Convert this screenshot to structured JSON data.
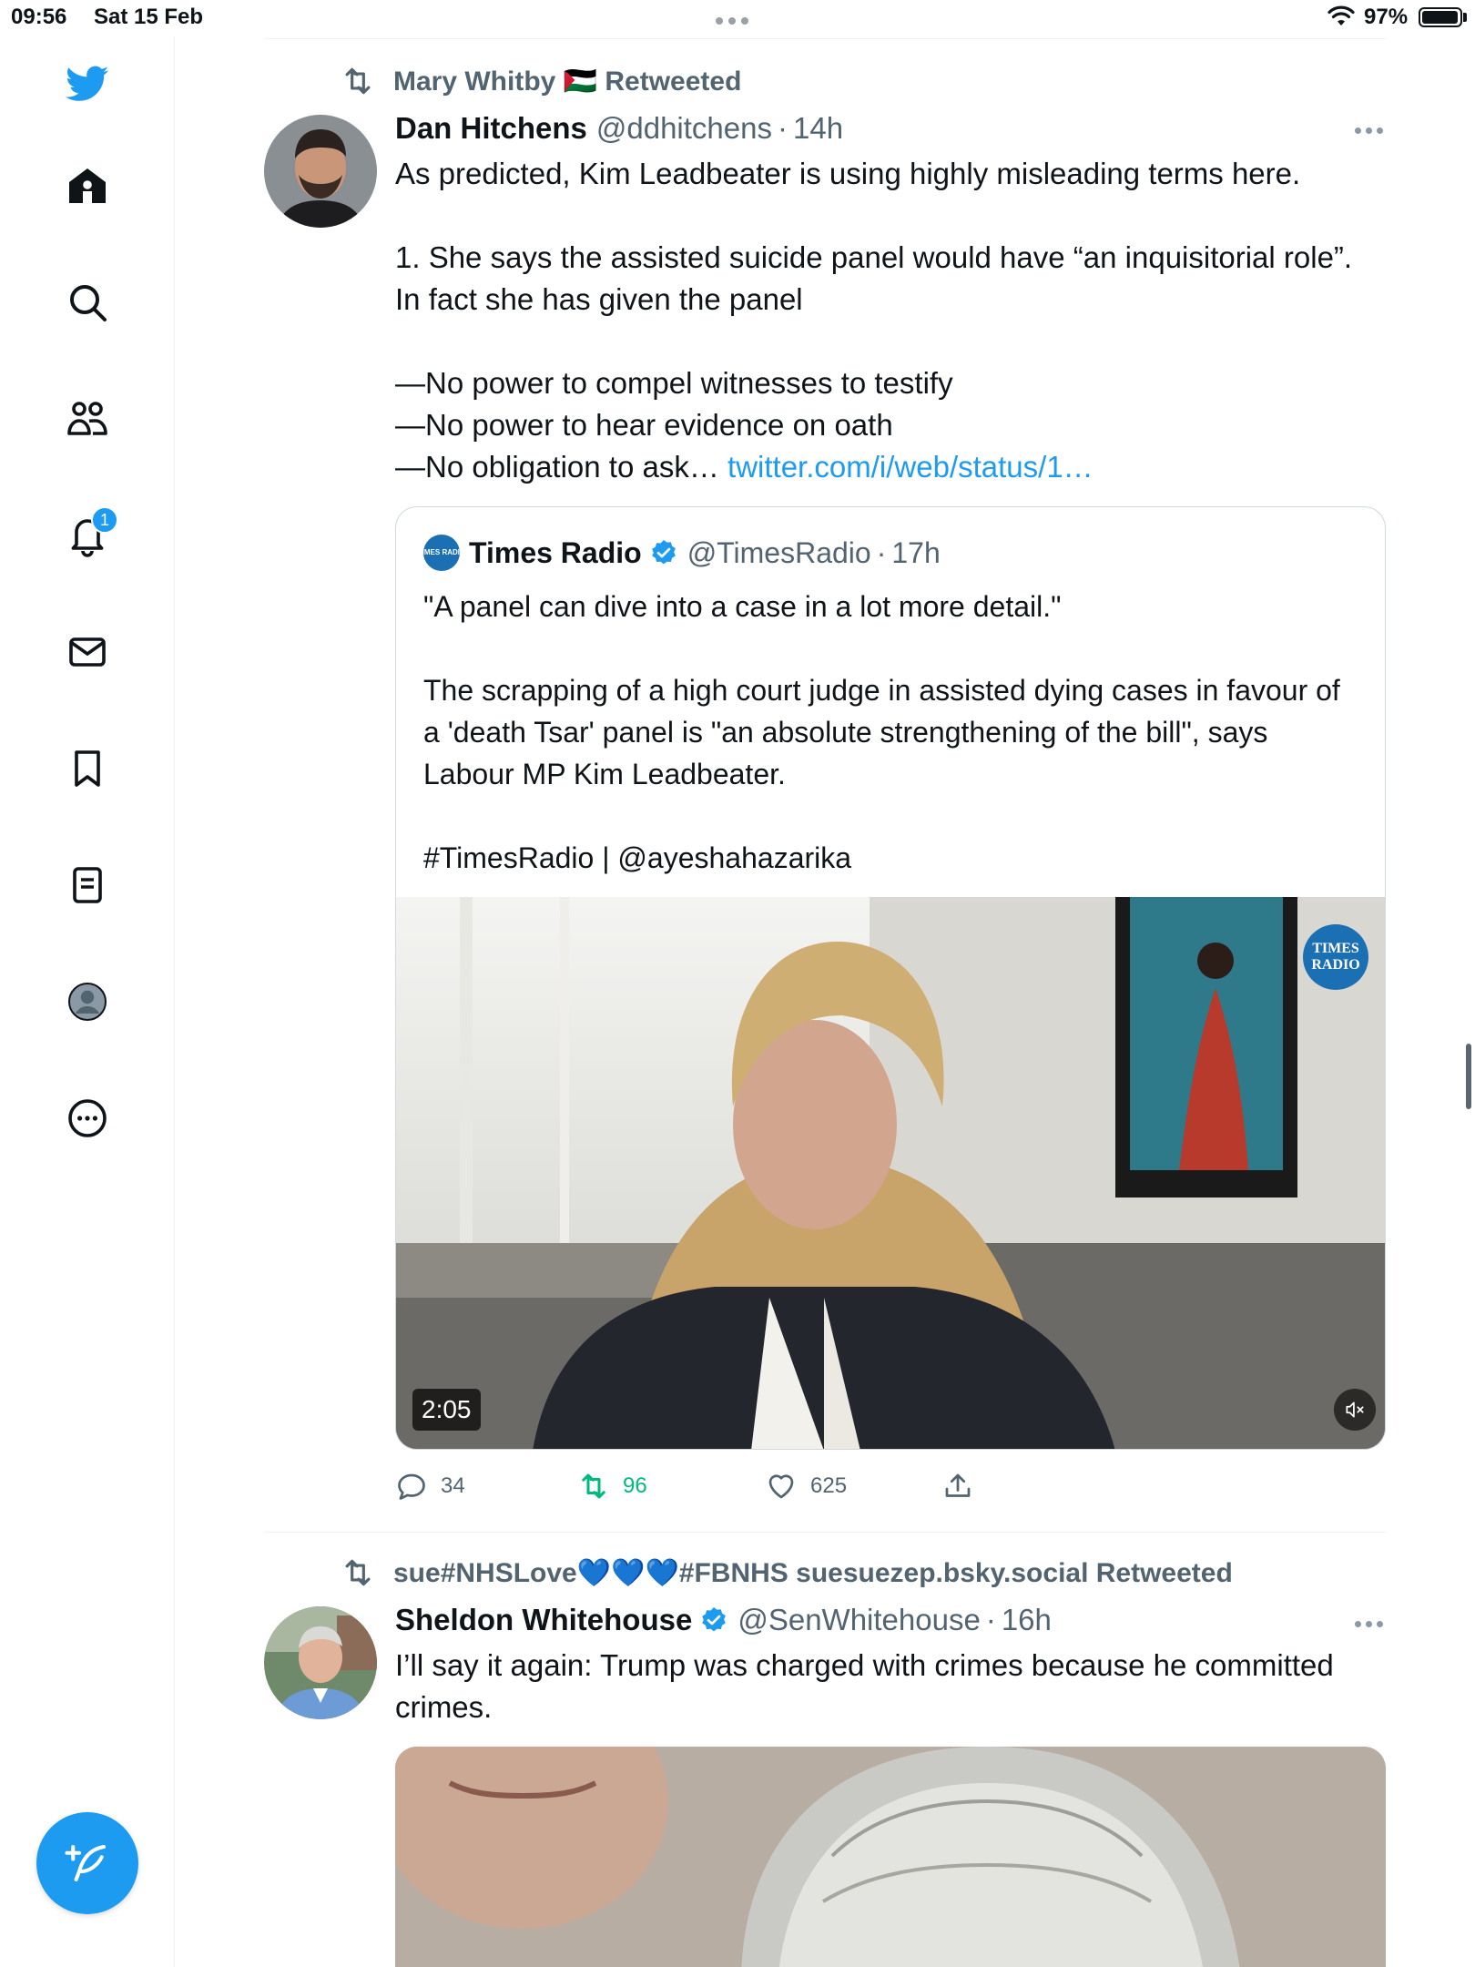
{
  "status_bar": {
    "time": "09:56",
    "date": "Sat 15 Feb",
    "battery": "97%",
    "battery_level": 0.97
  },
  "sidebar": {
    "logo": "twitter-bird-icon",
    "items": [
      {
        "name": "home",
        "icon": "home-icon"
      },
      {
        "name": "explore",
        "icon": "search-icon"
      },
      {
        "name": "communities",
        "icon": "communities-icon"
      },
      {
        "name": "notifications",
        "icon": "bell-icon",
        "badge": "1"
      },
      {
        "name": "messages",
        "icon": "mail-icon"
      },
      {
        "name": "bookmarks",
        "icon": "bookmark-icon"
      },
      {
        "name": "lists",
        "icon": "lists-icon"
      },
      {
        "name": "profile",
        "icon": "profile-avatar-icon"
      },
      {
        "name": "more",
        "icon": "more-circle-icon"
      }
    ],
    "compose_icon": "compose-feather-icon"
  },
  "colors": {
    "accent": "#1d9bf0",
    "retweet_active": "#00ba7c",
    "muted_text": "#536471"
  },
  "tweets": [
    {
      "retweeted_by": "Mary Whitby 🇵🇸 Retweeted",
      "name": "Dan Hitchens",
      "handle": "@ddhitchens",
      "dot": "·",
      "time": "14h",
      "text": [
        "As predicted, Kim Leadbeater is using highly misleading terms here.",
        "",
        "1. She says the assisted suicide panel would have “an inquisitorial role”. In fact she has given the panel",
        "",
        "—No power to compel witnesses to testify",
        "—No power to hear evidence on oath",
        "—No obligation to ask…"
      ],
      "link": "twitter.com/i/web/status/1…",
      "quote": {
        "name": "Times Radio",
        "handle": "@TimesRadio",
        "dot": "·",
        "time": "17h",
        "avatar_text": "TIMES RADIO",
        "text": [
          "\"A panel can dive into a case in a lot more detail.\"",
          "",
          "The scrapping of a high court judge in assisted dying cases in favour of a 'death Tsar' panel is \"an absolute strengthening of the bill\", says Labour MP Kim Leadbeater.",
          "",
          "#TimesRadio | @ayeshahazarika"
        ],
        "video_duration": "2:05",
        "video_logo": "TIMES RADIO"
      },
      "actions": {
        "replies": "34",
        "retweets": "96",
        "likes": "625"
      }
    },
    {
      "retweeted_by": "sue#NHSLove💙💙💙#FBNHS suesuezep.bsky.social Retweeted",
      "name": "Sheldon Whitehouse",
      "handle": "@SenWhitehouse",
      "dot": "·",
      "time": "16h",
      "verified": true,
      "text": [
        "I’ll say it again: Trump was charged with crimes because he committed crimes."
      ]
    }
  ]
}
